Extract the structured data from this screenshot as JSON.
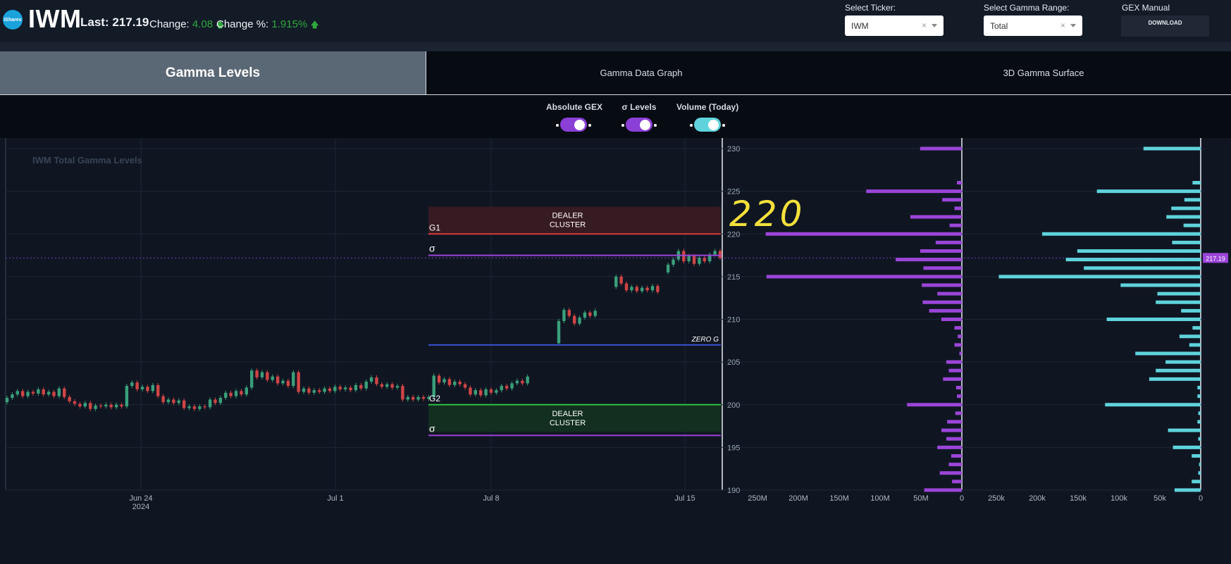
{
  "header": {
    "logo_text": "iShares",
    "ticker": "IWM",
    "last_label": "Last:",
    "last_value": "217.19",
    "change_label": "Change:",
    "change_value": "4.08",
    "change_pct_label": "Change %:",
    "change_pct_value": "1.915%",
    "select_ticker_label": "Select Ticker:",
    "select_ticker_value": "IWM",
    "select_gamma_label": "Select Gamma Range:",
    "select_gamma_value": "Total",
    "gex_manual_label": "GEX Manual",
    "download_label": "DOWNLOAD",
    "clear_glyph": "×"
  },
  "tabs": [
    {
      "label": "Gamma Levels",
      "active": true
    },
    {
      "label": "Gamma Data Graph",
      "active": false
    },
    {
      "label": "3D Gamma Surface",
      "active": false
    }
  ],
  "toggles": [
    {
      "label": "Absolute GEX",
      "on": true,
      "color": "#8a3fd6"
    },
    {
      "label": "σ Levels",
      "on": true,
      "color": "#8a3fd6"
    },
    {
      "label": "Volume (Today)",
      "on": true,
      "color": "#5fd3dc"
    }
  ],
  "colors": {
    "gex_bar": "#9b45d9",
    "volume_bar": "#5fd3dc",
    "g1_line": "#d63a3a",
    "g2_line": "#2fbf3f",
    "sigma_line": "#9b45d9",
    "zero_g_line": "#3a4fd6",
    "up_candle": "#3aa07a",
    "down_candle": "#d04545",
    "annotation": "#f4e03a",
    "price_tag": "#9b45d9"
  },
  "chart_data": {
    "type": "candlestick",
    "title": "IWM Total Gamma Levels",
    "ylim": [
      190,
      231
    ],
    "y_ticks": [
      "230",
      "225",
      "220",
      "215",
      "210",
      "205",
      "200",
      "195",
      "190"
    ],
    "x_ticks": [
      "Jun 24\n2024",
      "Jul 1",
      "Jul 8",
      "Jul 15"
    ],
    "last_price": "217.19",
    "levels": [
      {
        "name": "G1",
        "value": 220.0,
        "kind": "g1"
      },
      {
        "name": "σ",
        "value": 217.5,
        "kind": "sigma"
      },
      {
        "name": "ZERO G",
        "value": 207.0,
        "kind": "zero"
      },
      {
        "name": "G2",
        "value": 200.0,
        "kind": "g2"
      },
      {
        "name": "σ",
        "value": 196.4,
        "kind": "sigma"
      }
    ],
    "dealer_clusters": [
      {
        "label": "DEALER\nCLUSTER",
        "from": 220.0,
        "to": 223.2,
        "tone": "red"
      },
      {
        "label": "DEALER\nCLUSTER",
        "from": 196.8,
        "to": 200.0,
        "tone": "green"
      }
    ],
    "annotation": "220",
    "price_path": [
      {
        "t": 0,
        "o": 200.3,
        "c": 200.8
      },
      {
        "t": 1,
        "o": 200.8,
        "c": 201.2
      },
      {
        "t": 2,
        "o": 201.2,
        "c": 201.6
      },
      {
        "t": 3,
        "o": 201.6,
        "c": 201.0
      },
      {
        "t": 4,
        "o": 201.0,
        "c": 201.5
      },
      {
        "t": 5,
        "o": 201.5,
        "c": 201.3
      },
      {
        "t": 6,
        "o": 201.3,
        "c": 201.8
      },
      {
        "t": 7,
        "o": 201.8,
        "c": 201.2
      },
      {
        "t": 8,
        "o": 201.2,
        "c": 201.5
      },
      {
        "t": 9,
        "o": 201.5,
        "c": 201.0
      },
      {
        "t": 10,
        "o": 201.0,
        "c": 201.9
      },
      {
        "t": 11,
        "o": 201.9,
        "c": 200.9
      },
      {
        "t": 12,
        "o": 200.9,
        "c": 200.4
      },
      {
        "t": 13,
        "o": 200.4,
        "c": 200.1
      },
      {
        "t": 14,
        "o": 200.1,
        "c": 199.8
      },
      {
        "t": 15,
        "o": 199.8,
        "c": 200.2
      },
      {
        "t": 16,
        "o": 200.2,
        "c": 199.5
      },
      {
        "t": 17,
        "o": 199.5,
        "c": 199.9
      },
      {
        "t": 18,
        "o": 199.9,
        "c": 199.8
      },
      {
        "t": 19,
        "o": 199.8,
        "c": 200.0
      },
      {
        "t": 20,
        "o": 200.0,
        "c": 199.7
      },
      {
        "t": 21,
        "o": 199.7,
        "c": 200.0
      },
      {
        "t": 22,
        "o": 200.0,
        "c": 199.8
      },
      {
        "t": 23,
        "o": 199.8,
        "c": 202.2
      },
      {
        "t": 24,
        "o": 202.2,
        "c": 202.6
      },
      {
        "t": 25,
        "o": 202.6,
        "c": 201.8
      },
      {
        "t": 26,
        "o": 201.8,
        "c": 202.1
      },
      {
        "t": 27,
        "o": 202.1,
        "c": 201.6
      },
      {
        "t": 28,
        "o": 201.6,
        "c": 202.3
      },
      {
        "t": 29,
        "o": 202.3,
        "c": 201.0
      },
      {
        "t": 30,
        "o": 201.0,
        "c": 200.3
      },
      {
        "t": 31,
        "o": 200.3,
        "c": 200.6
      },
      {
        "t": 32,
        "o": 200.6,
        "c": 200.2
      },
      {
        "t": 33,
        "o": 200.2,
        "c": 200.5
      },
      {
        "t": 34,
        "o": 200.5,
        "c": 199.6
      },
      {
        "t": 35,
        "o": 199.6,
        "c": 199.8
      },
      {
        "t": 36,
        "o": 199.8,
        "c": 199.5
      },
      {
        "t": 37,
        "o": 199.5,
        "c": 199.8
      },
      {
        "t": 38,
        "o": 199.8,
        "c": 199.7
      },
      {
        "t": 39,
        "o": 199.7,
        "c": 200.6
      },
      {
        "t": 40,
        "o": 200.6,
        "c": 200.2
      },
      {
        "t": 41,
        "o": 200.2,
        "c": 200.8
      },
      {
        "t": 42,
        "o": 200.8,
        "c": 201.4
      },
      {
        "t": 43,
        "o": 201.4,
        "c": 201.0
      },
      {
        "t": 44,
        "o": 201.0,
        "c": 201.6
      },
      {
        "t": 45,
        "o": 201.6,
        "c": 201.2
      },
      {
        "t": 46,
        "o": 201.2,
        "c": 202.0
      },
      {
        "t": 47,
        "o": 202.0,
        "c": 204.0
      },
      {
        "t": 48,
        "o": 204.0,
        "c": 203.2
      },
      {
        "t": 49,
        "o": 203.2,
        "c": 203.8
      },
      {
        "t": 50,
        "o": 203.8,
        "c": 202.9
      },
      {
        "t": 51,
        "o": 202.9,
        "c": 203.3
      },
      {
        "t": 52,
        "o": 203.3,
        "c": 202.5
      },
      {
        "t": 53,
        "o": 202.5,
        "c": 202.8
      },
      {
        "t": 54,
        "o": 202.8,
        "c": 202.2
      },
      {
        "t": 55,
        "o": 202.2,
        "c": 203.8
      },
      {
        "t": 56,
        "o": 203.8,
        "c": 201.5
      },
      {
        "t": 57,
        "o": 201.5,
        "c": 201.9
      },
      {
        "t": 58,
        "o": 201.9,
        "c": 201.4
      },
      {
        "t": 59,
        "o": 201.4,
        "c": 201.7
      },
      {
        "t": 60,
        "o": 201.7,
        "c": 201.5
      },
      {
        "t": 61,
        "o": 201.5,
        "c": 201.9
      },
      {
        "t": 62,
        "o": 201.9,
        "c": 201.6
      },
      {
        "t": 63,
        "o": 201.6,
        "c": 202.1
      },
      {
        "t": 64,
        "o": 202.1,
        "c": 201.8
      },
      {
        "t": 65,
        "o": 201.8,
        "c": 202.0
      },
      {
        "t": 66,
        "o": 202.0,
        "c": 201.7
      },
      {
        "t": 67,
        "o": 201.7,
        "c": 202.3
      },
      {
        "t": 68,
        "o": 202.3,
        "c": 201.9
      },
      {
        "t": 69,
        "o": 201.9,
        "c": 202.7
      },
      {
        "t": 70,
        "o": 202.7,
        "c": 203.2
      },
      {
        "t": 71,
        "o": 203.2,
        "c": 202.4
      },
      {
        "t": 72,
        "o": 202.4,
        "c": 202.1
      },
      {
        "t": 73,
        "o": 202.1,
        "c": 202.4
      },
      {
        "t": 74,
        "o": 202.4,
        "c": 202.0
      },
      {
        "t": 75,
        "o": 202.0,
        "c": 202.2
      },
      {
        "t": 76,
        "o": 202.2,
        "c": 200.6
      },
      {
        "t": 77,
        "o": 200.6,
        "c": 200.9
      },
      {
        "t": 78,
        "o": 200.9,
        "c": 200.6
      },
      {
        "t": 79,
        "o": 200.6,
        "c": 200.9
      },
      {
        "t": 80,
        "o": 200.9,
        "c": 200.7
      },
      {
        "t": 81,
        "o": 200.7,
        "c": 200.9
      },
      {
        "t": 82,
        "o": 200.9,
        "c": 203.4
      },
      {
        "t": 83,
        "o": 203.4,
        "c": 202.6
      },
      {
        "t": 84,
        "o": 202.6,
        "c": 203.0
      },
      {
        "t": 85,
        "o": 203.0,
        "c": 202.3
      },
      {
        "t": 86,
        "o": 202.3,
        "c": 202.7
      },
      {
        "t": 87,
        "o": 202.7,
        "c": 202.4
      },
      {
        "t": 88,
        "o": 202.4,
        "c": 202.0
      },
      {
        "t": 89,
        "o": 202.0,
        "c": 201.2
      },
      {
        "t": 90,
        "o": 201.2,
        "c": 201.7
      },
      {
        "t": 91,
        "o": 201.7,
        "c": 201.1
      },
      {
        "t": 92,
        "o": 201.1,
        "c": 201.8
      },
      {
        "t": 93,
        "o": 201.8,
        "c": 201.4
      },
      {
        "t": 94,
        "o": 201.4,
        "c": 201.7
      },
      {
        "t": 95,
        "o": 201.7,
        "c": 202.2
      },
      {
        "t": 96,
        "o": 202.2,
        "c": 201.9
      },
      {
        "t": 97,
        "o": 201.9,
        "c": 202.5
      },
      {
        "t": 98,
        "o": 202.5,
        "c": 202.8
      },
      {
        "t": 99,
        "o": 202.8,
        "c": 202.5
      },
      {
        "t": 100,
        "o": 202.5,
        "c": 203.3
      },
      {
        "t": 106,
        "o": 207.2,
        "c": 209.8
      },
      {
        "t": 107,
        "o": 209.8,
        "c": 211.1
      },
      {
        "t": 108,
        "o": 211.1,
        "c": 210.4
      },
      {
        "t": 109,
        "o": 210.4,
        "c": 209.5
      },
      {
        "t": 110,
        "o": 209.5,
        "c": 210.2
      },
      {
        "t": 111,
        "o": 210.2,
        "c": 210.8
      },
      {
        "t": 112,
        "o": 210.8,
        "c": 210.4
      },
      {
        "t": 113,
        "o": 210.4,
        "c": 211.0
      },
      {
        "t": 117,
        "o": 213.8,
        "c": 215.0
      },
      {
        "t": 118,
        "o": 215.0,
        "c": 214.2
      },
      {
        "t": 119,
        "o": 214.2,
        "c": 213.4
      },
      {
        "t": 120,
        "o": 213.4,
        "c": 213.8
      },
      {
        "t": 121,
        "o": 213.8,
        "c": 213.3
      },
      {
        "t": 122,
        "o": 213.3,
        "c": 213.7
      },
      {
        "t": 123,
        "o": 213.7,
        "c": 213.4
      },
      {
        "t": 124,
        "o": 213.4,
        "c": 213.9
      },
      {
        "t": 125,
        "o": 213.9,
        "c": 213.2
      },
      {
        "t": 127,
        "o": 215.5,
        "c": 216.4
      },
      {
        "t": 128,
        "o": 216.4,
        "c": 217.0
      },
      {
        "t": 129,
        "o": 217.0,
        "c": 218.0
      },
      {
        "t": 130,
        "o": 218.0,
        "c": 216.8
      },
      {
        "t": 131,
        "o": 216.8,
        "c": 217.4
      },
      {
        "t": 132,
        "o": 217.4,
        "c": 216.5
      },
      {
        "t": 133,
        "o": 216.5,
        "c": 217.2
      },
      {
        "t": 134,
        "o": 217.2,
        "c": 216.8
      },
      {
        "t": 135,
        "o": 216.8,
        "c": 217.6
      },
      {
        "t": 136,
        "o": 217.6,
        "c": 218.0
      },
      {
        "t": 137,
        "o": 218.0,
        "c": 217.2
      }
    ],
    "gex_axis_ticks": [
      "250M",
      "200M",
      "150M",
      "100M",
      "50M",
      "0"
    ],
    "gex_bars": [
      {
        "strike": 230,
        "value": 51
      },
      {
        "strike": 226,
        "value": 6
      },
      {
        "strike": 225,
        "value": 117
      },
      {
        "strike": 224,
        "value": 24
      },
      {
        "strike": 223,
        "value": 9
      },
      {
        "strike": 222,
        "value": 63
      },
      {
        "strike": 221,
        "value": 15
      },
      {
        "strike": 220,
        "value": 240
      },
      {
        "strike": 219,
        "value": 32
      },
      {
        "strike": 218,
        "value": 51
      },
      {
        "strike": 217,
        "value": 81
      },
      {
        "strike": 216,
        "value": 47
      },
      {
        "strike": 215,
        "value": 239
      },
      {
        "strike": 214,
        "value": 49
      },
      {
        "strike": 213,
        "value": 30
      },
      {
        "strike": 212,
        "value": 48
      },
      {
        "strike": 211,
        "value": 40
      },
      {
        "strike": 210,
        "value": 25
      },
      {
        "strike": 209,
        "value": 9
      },
      {
        "strike": 208,
        "value": 5
      },
      {
        "strike": 207,
        "value": 9
      },
      {
        "strike": 206,
        "value": 3
      },
      {
        "strike": 205,
        "value": 19
      },
      {
        "strike": 204,
        "value": 16
      },
      {
        "strike": 203,
        "value": 23
      },
      {
        "strike": 202,
        "value": 7
      },
      {
        "strike": 201,
        "value": 6
      },
      {
        "strike": 200,
        "value": 67
      },
      {
        "strike": 199,
        "value": 8
      },
      {
        "strike": 198,
        "value": 18
      },
      {
        "strike": 197,
        "value": 25
      },
      {
        "strike": 196,
        "value": 19
      },
      {
        "strike": 195,
        "value": 30
      },
      {
        "strike": 194,
        "value": 13
      },
      {
        "strike": 193,
        "value": 16
      },
      {
        "strike": 192,
        "value": 27
      },
      {
        "strike": 191,
        "value": 12
      },
      {
        "strike": 190,
        "value": 46
      }
    ],
    "volume_axis_ticks": [
      "250k",
      "200k",
      "150k",
      "100k",
      "50k",
      "0"
    ],
    "volume_bars": [
      {
        "strike": 230,
        "value": 70
      },
      {
        "strike": 226,
        "value": 10
      },
      {
        "strike": 225,
        "value": 127
      },
      {
        "strike": 224,
        "value": 20
      },
      {
        "strike": 223,
        "value": 36
      },
      {
        "strike": 222,
        "value": 42
      },
      {
        "strike": 221,
        "value": 21
      },
      {
        "strike": 220,
        "value": 194
      },
      {
        "strike": 219,
        "value": 35
      },
      {
        "strike": 218,
        "value": 151
      },
      {
        "strike": 217,
        "value": 165
      },
      {
        "strike": 216,
        "value": 143
      },
      {
        "strike": 215,
        "value": 247
      },
      {
        "strike": 214,
        "value": 98
      },
      {
        "strike": 213,
        "value": 53
      },
      {
        "strike": 212,
        "value": 55
      },
      {
        "strike": 211,
        "value": 24
      },
      {
        "strike": 210,
        "value": 115
      },
      {
        "strike": 209,
        "value": 10
      },
      {
        "strike": 208,
        "value": 26
      },
      {
        "strike": 207,
        "value": 14
      },
      {
        "strike": 206,
        "value": 80
      },
      {
        "strike": 205,
        "value": 43
      },
      {
        "strike": 204,
        "value": 55
      },
      {
        "strike": 203,
        "value": 63
      },
      {
        "strike": 202,
        "value": 4
      },
      {
        "strike": 201,
        "value": 4
      },
      {
        "strike": 200,
        "value": 117
      },
      {
        "strike": 199,
        "value": 3
      },
      {
        "strike": 198,
        "value": 4
      },
      {
        "strike": 197,
        "value": 40
      },
      {
        "strike": 196,
        "value": 3
      },
      {
        "strike": 195,
        "value": 34
      },
      {
        "strike": 194,
        "value": 11
      },
      {
        "strike": 193,
        "value": 2
      },
      {
        "strike": 192,
        "value": 3
      },
      {
        "strike": 191,
        "value": 11
      },
      {
        "strike": 190,
        "value": 32
      }
    ]
  }
}
